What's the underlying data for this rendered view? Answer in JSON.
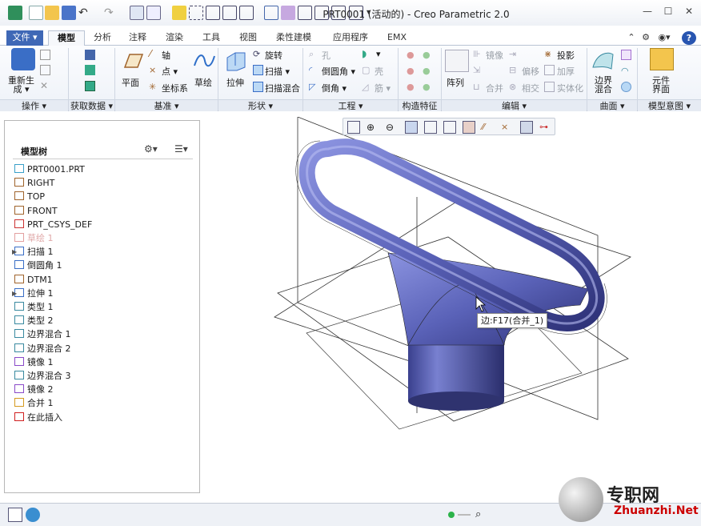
{
  "window": {
    "title": "PRT0001 (活动的) - Creo Parametric 2.0",
    "minimize": "—",
    "maximize": "☐",
    "close": "✕"
  },
  "tabs": [
    {
      "label": "文件 ▾"
    },
    {
      "label": "模型"
    },
    {
      "label": "分析"
    },
    {
      "label": "注释"
    },
    {
      "label": "渲染"
    },
    {
      "label": "工具"
    },
    {
      "label": "视图"
    },
    {
      "label": "柔性建模"
    },
    {
      "label": "应用程序"
    },
    {
      "label": "EMX"
    }
  ],
  "ribbon": {
    "regenerate": "重新生\n成 ▾",
    "plane": "平面",
    "axis": "轴",
    "point": "点 ▾",
    "csys": "坐标系",
    "sketch": "草绘",
    "extrude": "拉伸",
    "revolve": "旋转",
    "sweep": "扫描 ▾",
    "swept_blend": "扫描混合",
    "hole": "孔",
    "round": "倒圆角 ▾",
    "chamfer": "倒角 ▾",
    "shell": "壳",
    "rib": "筋 ▾",
    "draft_symbol": "▾",
    "pattern": "阵列",
    "mirror": "镜像",
    "extend": "延伸",
    "merge": "合并",
    "offset": "偏移",
    "intersect": "相交",
    "project": "投影",
    "thicken": "加厚",
    "solidify": "实体化",
    "boundary_blend": "边界\n混合",
    "component_interface": "元件\n界面",
    "groups": [
      {
        "label": "操作 ▾"
      },
      {
        "label": "获取数据 ▾"
      },
      {
        "label": "基准 ▾"
      },
      {
        "label": "形状 ▾"
      },
      {
        "label": "工程 ▾"
      },
      {
        "label": "构造特征"
      },
      {
        "label": "编辑 ▾"
      },
      {
        "label": "曲面 ▾"
      },
      {
        "label": "模型意图 ▾"
      }
    ]
  },
  "model_tree": {
    "title": "模型树",
    "items": [
      {
        "label": "PRT0001.PRT",
        "dim": false,
        "expand": false
      },
      {
        "label": "RIGHT",
        "dim": false,
        "expand": false
      },
      {
        "label": "TOP",
        "dim": false,
        "expand": false
      },
      {
        "label": "FRONT",
        "dim": false,
        "expand": false
      },
      {
        "label": "PRT_CSYS_DEF",
        "dim": false,
        "expand": false
      },
      {
        "label": "草绘 1",
        "dim": true,
        "expand": false
      },
      {
        "label": "扫描 1",
        "dim": false,
        "expand": true
      },
      {
        "label": "倒圆角 1",
        "dim": false,
        "expand": false
      },
      {
        "label": "DTM1",
        "dim": false,
        "expand": false
      },
      {
        "label": "拉伸 1",
        "dim": false,
        "expand": true
      },
      {
        "label": "类型 1",
        "dim": false,
        "expand": false
      },
      {
        "label": "类型 2",
        "dim": false,
        "expand": false
      },
      {
        "label": "边界混合 1",
        "dim": false,
        "expand": false
      },
      {
        "label": "边界混合 2",
        "dim": false,
        "expand": false
      },
      {
        "label": "镜像 1",
        "dim": false,
        "expand": false
      },
      {
        "label": "边界混合 3",
        "dim": false,
        "expand": false
      },
      {
        "label": "镜像 2",
        "dim": false,
        "expand": false
      },
      {
        "label": "合并 1",
        "dim": false,
        "expand": false
      },
      {
        "label": "在此插入",
        "dim": false,
        "expand": false
      }
    ]
  },
  "graphics": {
    "tooltip": "边:F17(合并_1)",
    "model_color": "#5a62b8"
  },
  "watermark": {
    "name": "专职网",
    "url": "Zhuanzhi.Net"
  }
}
